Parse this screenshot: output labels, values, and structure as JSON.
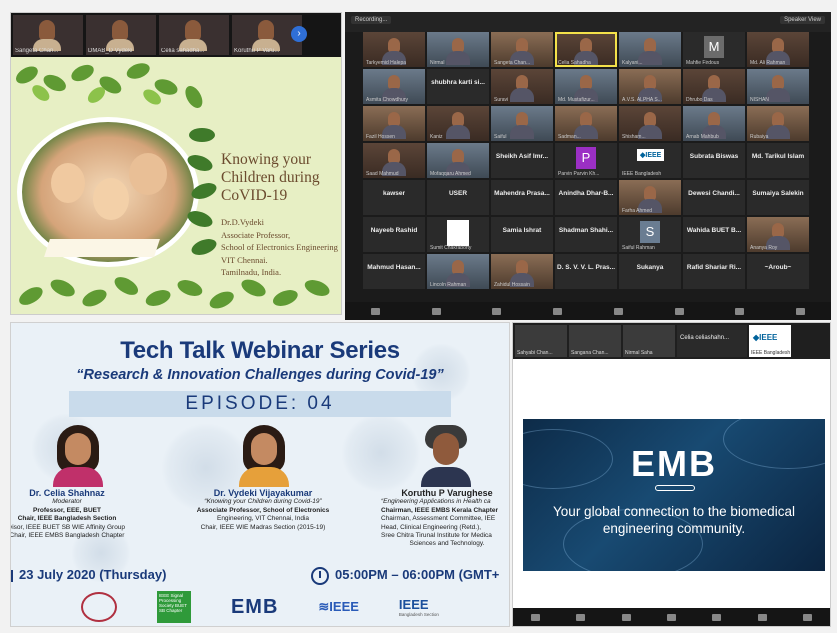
{
  "slide_panel": {
    "thumbnails": [
      {
        "name": "Sangeta Chan..."
      },
      {
        "name": "DMAB_D Vydeki"
      },
      {
        "name": "Celia sahadha..."
      },
      {
        "name": "Koruthu P Varu..."
      }
    ],
    "title": "Knowing your Children during CoVID-19",
    "author_lines": [
      "Dr.D.Vydeki",
      "Associate Professor,",
      "School of Electronics Engineering",
      "VIT Chennai.",
      "Tamilnadu, India."
    ]
  },
  "gallery_panel": {
    "recording_label": "Recording...",
    "view_label": "Speaker View",
    "tiles": [
      {
        "kind": "video",
        "label": "Tarkyemid Halepa"
      },
      {
        "kind": "video",
        "label": "Nirmal"
      },
      {
        "kind": "video",
        "label": "Sangeta Chan..."
      },
      {
        "kind": "video-selected",
        "label": "Celia Sahadha"
      },
      {
        "kind": "video",
        "label": "Kalyani..."
      },
      {
        "kind": "letter-m",
        "letter": "M",
        "label": "Mahfie Firdous"
      },
      {
        "kind": "video",
        "label": "Md. Ali Rahman"
      },
      {
        "kind": "video",
        "label": "Asmita Chowdhury"
      },
      {
        "kind": "name",
        "text": "shubhra karti si..."
      },
      {
        "kind": "video",
        "label": "Suravi"
      },
      {
        "kind": "video",
        "label": "Md. Mustafizur..."
      },
      {
        "kind": "video",
        "label": "A.V.S. ALPHA S..."
      },
      {
        "kind": "video",
        "label": "Dhrubo Das"
      },
      {
        "kind": "video",
        "label": "NISHAN"
      },
      {
        "kind": "video",
        "label": "Fazil Hossen"
      },
      {
        "kind": "video",
        "label": "Kaniz"
      },
      {
        "kind": "video",
        "label": "Saiful"
      },
      {
        "kind": "video",
        "label": "Sadman..."
      },
      {
        "kind": "video",
        "label": "Shisham..."
      },
      {
        "kind": "video",
        "label": "Arnab Mahbub"
      },
      {
        "kind": "video",
        "label": "Rubaiya"
      },
      {
        "kind": "video",
        "label": "Saad Mahmud"
      },
      {
        "kind": "video",
        "label": "Mofaqqaru Ahmed"
      },
      {
        "kind": "name",
        "text": "Sheikh Asif Imr..."
      },
      {
        "kind": "letter-p",
        "letter": "P",
        "label": "Parvin Parvin Kh..."
      },
      {
        "kind": "ieee",
        "label": "IEEE Bangladesh"
      },
      {
        "kind": "name",
        "text": "Subrata Biswas"
      },
      {
        "kind": "name",
        "text": "Md. Tarikul Islam"
      },
      {
        "kind": "name",
        "text": "kawser"
      },
      {
        "kind": "name",
        "text": "USER"
      },
      {
        "kind": "name",
        "text": "Mahendra Prasa..."
      },
      {
        "kind": "name",
        "text": "Anindha Dhar-B..."
      },
      {
        "kind": "video",
        "label": "Farha Ahmed"
      },
      {
        "kind": "name",
        "text": "Dewesi Chandi..."
      },
      {
        "kind": "name",
        "text": "Sumaiya Salekin"
      },
      {
        "kind": "name",
        "text": "Nayeeb Rashid"
      },
      {
        "kind": "white",
        "label": "Sumit Chakraborty"
      },
      {
        "kind": "name",
        "text": "Samia Ishrat"
      },
      {
        "kind": "name",
        "text": "Shadman Shahi..."
      },
      {
        "kind": "letter-s",
        "letter": "S",
        "label": "Saiful Rahman"
      },
      {
        "kind": "name",
        "text": "Wahida BUET B..."
      },
      {
        "kind": "video",
        "label": "Ananya Roy"
      },
      {
        "kind": "name",
        "text": "Mahmud Hasan..."
      },
      {
        "kind": "video",
        "label": "Lincoln Rahman"
      },
      {
        "kind": "video",
        "label": "Zahidul Hossain"
      },
      {
        "kind": "name",
        "text": "D. S. V. V. L. Pras..."
      },
      {
        "kind": "name",
        "text": "Sukanya"
      },
      {
        "kind": "name",
        "text": "Rafid Shariar Ri..."
      },
      {
        "kind": "name",
        "text": "~Aroub~"
      }
    ]
  },
  "poster_panel": {
    "series_title": "Tech Talk Webinar Series",
    "subtitle": "“Research & Innovation Challenges during Covid-19”",
    "episode": "EPISODE: 04",
    "speakers": [
      {
        "name": "Dr. Celia Shahnaz",
        "lines": [
          {
            "text": "Moderator",
            "style": "it"
          },
          {
            "text": "Professor, EEE, BUET",
            "style": "b"
          },
          {
            "text": "Chair, IEEE Bangladesh Section",
            "style": "b"
          },
          {
            "text": "visor, IEEE BUET SB WIE Affinity Group",
            "style": ""
          },
          {
            "text": "Chair, IEEE EMBS Bangladesh Chapter",
            "style": ""
          }
        ]
      },
      {
        "name": "Dr. Vydeki Vijayakumar",
        "lines": [
          {
            "text": "“Knowing your Children during Covid-19”",
            "style": "it"
          },
          {
            "text": "Associate Professor, School of Electronics",
            "style": "b"
          },
          {
            "text": "Engineering, VIT Chennai, India",
            "style": ""
          },
          {
            "text": "Chair, IEEE WIE Madras Section (2015-19)",
            "style": ""
          }
        ]
      },
      {
        "name": "Koruthu P Varughese",
        "lines": [
          {
            "text": "“Engineering Applications in Health ca",
            "style": "it"
          },
          {
            "text": "Chairman, IEEE EMBS Kerala Chapter",
            "style": "b"
          },
          {
            "text": "Chairman, Assessment Committee, IEE",
            "style": ""
          },
          {
            "text": "Head, Clinical Engineering (Retd.),",
            "style": ""
          },
          {
            "text": "Sree Chitra Tirunal Institute for Medica",
            "style": ""
          },
          {
            "text": "Sciences and Technology.",
            "style": ""
          }
        ]
      }
    ],
    "date": "23 July 2020 (Thursday)",
    "time": "05:00PM – 06:00PM (GMT+",
    "logos": {
      "signal_processing": "IEEE Signal Processing Society BUET SB Chapter",
      "emb": "EMB",
      "ieee_bd": "IEEE",
      "ieee_bd_sub": "Bangladesh Section"
    }
  },
  "emb_panel": {
    "thumbnails": [
      {
        "name": "Sahyabi Chan..."
      },
      {
        "name": "Sangana Chan..."
      },
      {
        "name": "Nirmal Saha"
      }
    ],
    "named_tile": "Celia  celiashahn...",
    "ieee_tile": "◆IEEE",
    "ieee_tile_name": "IEEE Bangladesh",
    "logo": "EMB",
    "tagline": "Your global connection to the biomedical engineering community."
  }
}
